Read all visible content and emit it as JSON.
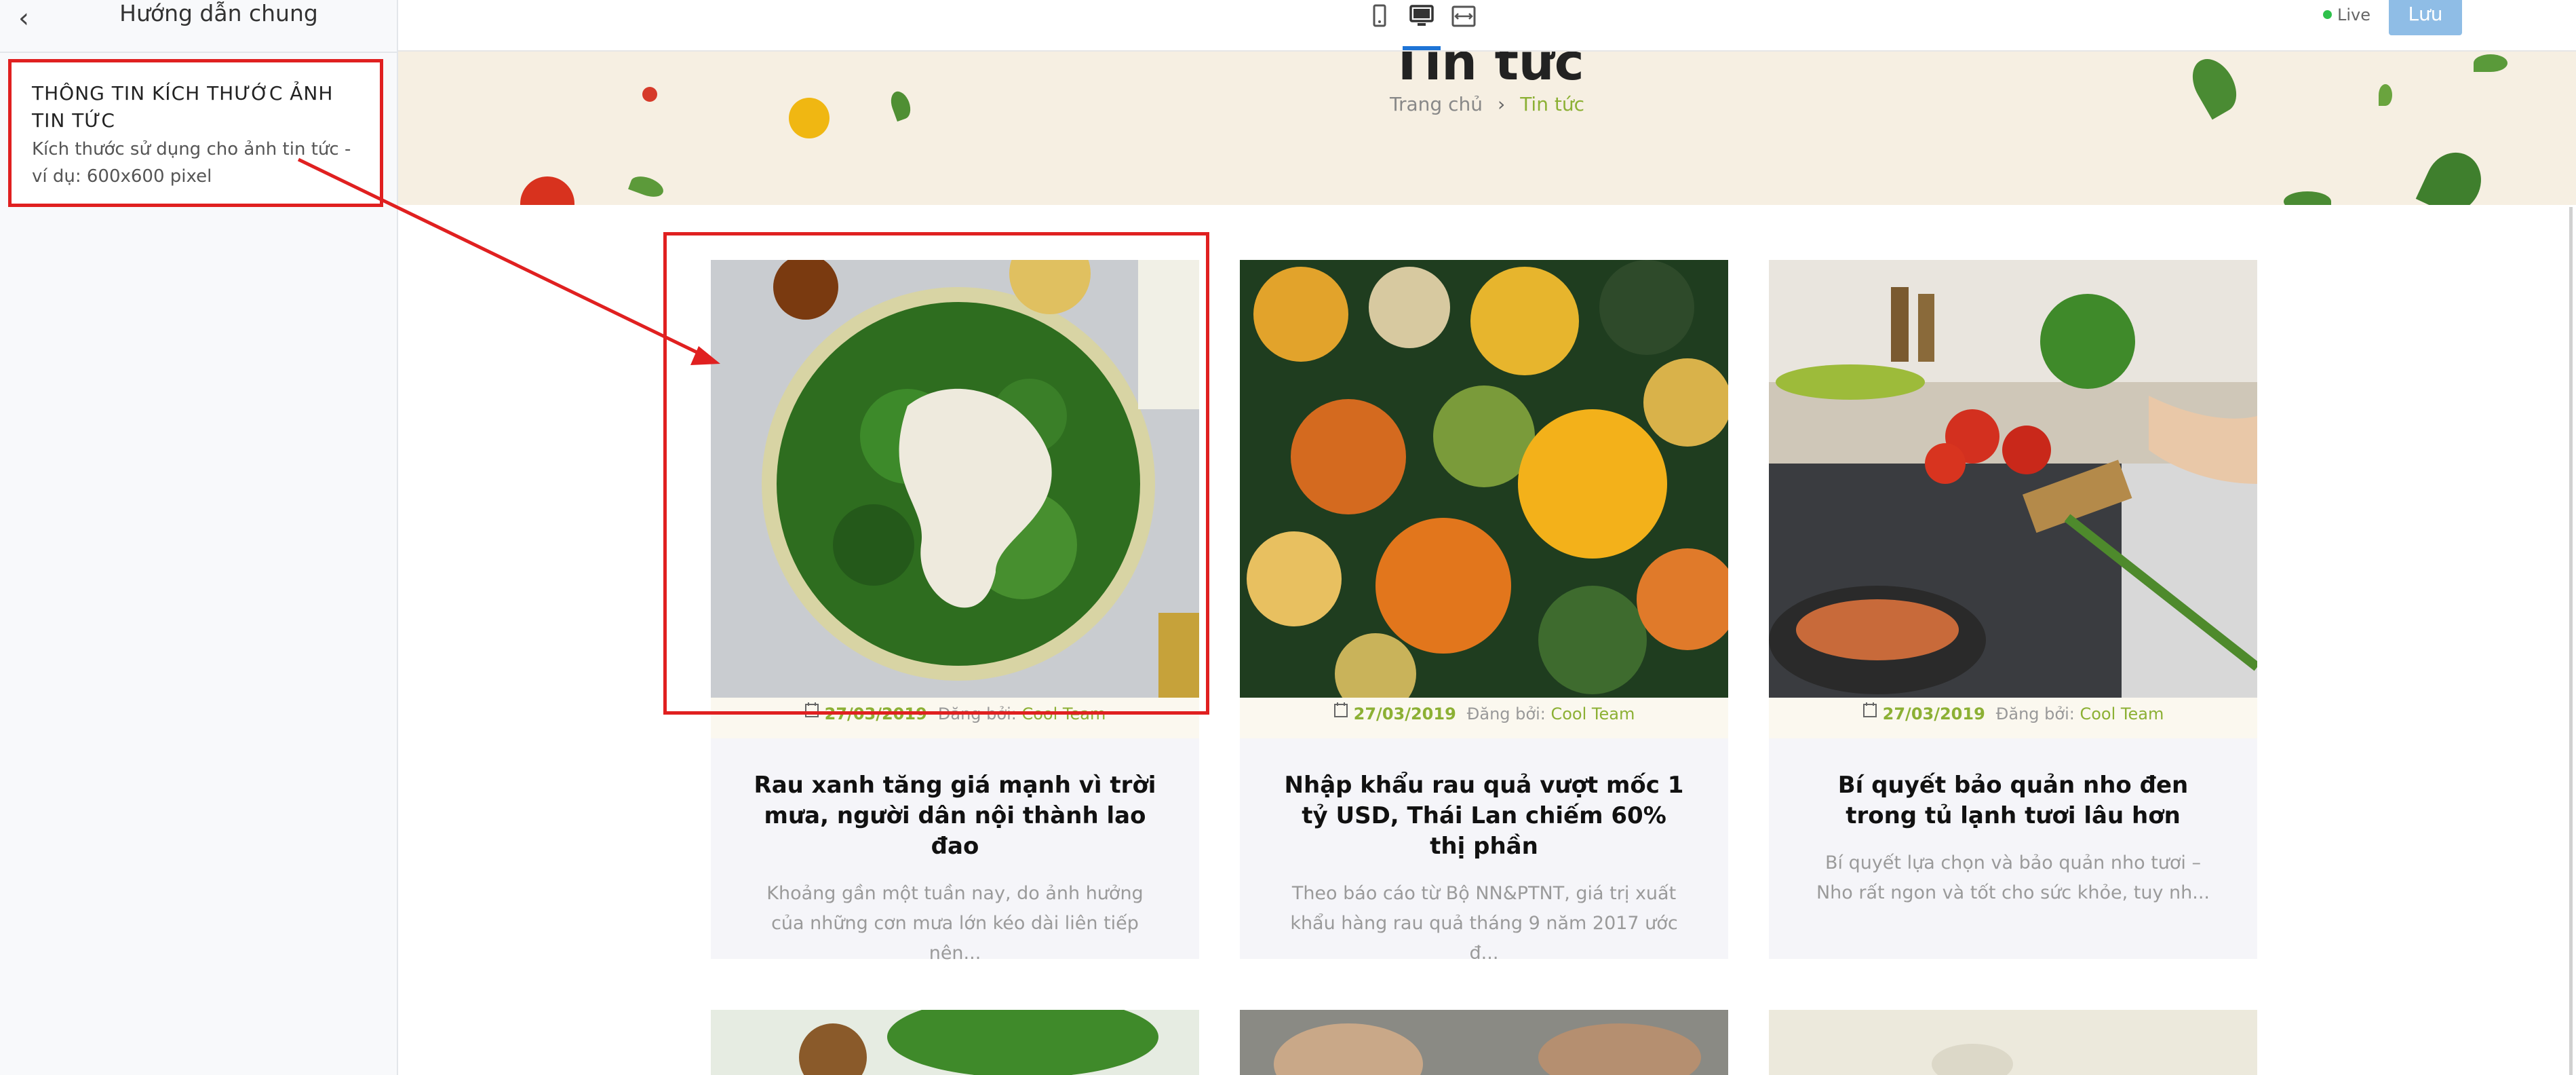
{
  "sidebar": {
    "back_icon": "chevron-left-icon",
    "title": "Hướng dẫn chung",
    "info_title": "THÔNG TIN KÍCH THƯỚC ẢNH TIN TỨC",
    "info_desc": "Kích thước sử dụng cho ảnh tin tức - ví dụ: 600x600 pixel"
  },
  "topbar": {
    "devices": [
      "mobile-icon",
      "desktop-icon",
      "fit-width-icon"
    ],
    "active_device": "desktop",
    "live_label": "Live",
    "save_label": "Lưu",
    "live_color": "#2ec14b",
    "save_color": "#8fbde6"
  },
  "banner": {
    "title": "Tin tức",
    "breadcrumb_home": "Trang chủ",
    "breadcrumb_current": "Tin tức"
  },
  "cards": [
    {
      "date": "27/03/2019",
      "posted_by": "Đăng bởi:",
      "author": "Cool Team",
      "title": "Rau xanh tăng giá mạnh vì trời mưa, người dân nội thành lao đao",
      "excerpt": "Khoảng gần một tuần nay, do ảnh hưởng của những cơn mưa lớn kéo dài liên tiếp nên..."
    },
    {
      "date": "27/03/2019",
      "posted_by": "Đăng bởi:",
      "author": "Cool Team",
      "title": "Nhập khẩu rau quả vượt mốc 1 tỷ USD, Thái Lan chiếm 60% thị phần",
      "excerpt": "Theo báo cáo từ Bộ NN&PTNT, giá trị xuất khẩu hàng rau quả tháng 9 năm 2017 ước đ..."
    },
    {
      "date": "27/03/2019",
      "posted_by": "Đăng bởi:",
      "author": "Cool Team",
      "title": "Bí quyết bảo quản nho đen trong tủ lạnh tươi lâu hơn",
      "excerpt": "Bí quyết lựa chọn và bảo quản nho tươi – Nho rất ngon và tốt cho sức khỏe, tuy nh..."
    }
  ],
  "colors": {
    "accent_green": "#8cb034",
    "highlight_red": "#e02020",
    "active_tab_blue": "#1e74d6"
  }
}
